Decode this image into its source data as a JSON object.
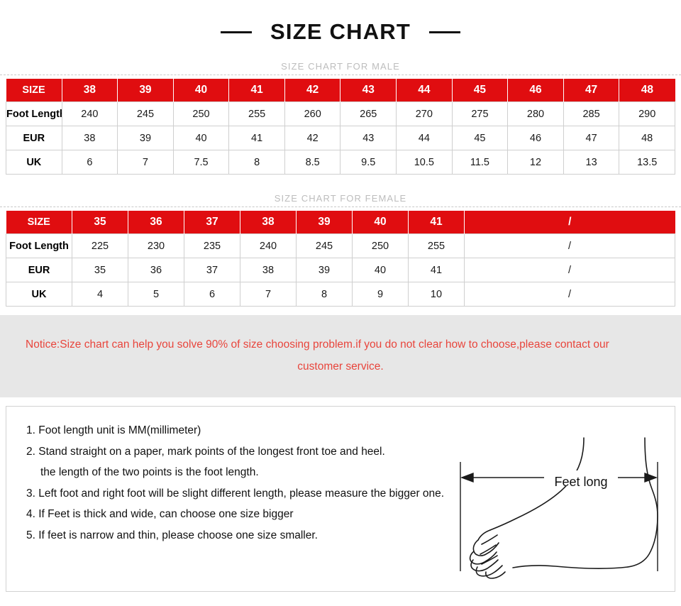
{
  "title": {
    "text": "SIZE CHART",
    "left_dash": "dash",
    "right_dash": "dash"
  },
  "male_section": {
    "caption": "SIZE CHART FOR MALE",
    "columns": [
      "SIZE",
      "38",
      "39",
      "40",
      "41",
      "42",
      "43",
      "44",
      "45",
      "46",
      "47",
      "48"
    ],
    "rows": [
      {
        "label": "Foot Length",
        "values": [
          "240",
          "245",
          "250",
          "255",
          "260",
          "265",
          "270",
          "275",
          "280",
          "285",
          "290"
        ]
      },
      {
        "label": "EUR",
        "values": [
          "38",
          "39",
          "40",
          "41",
          "42",
          "43",
          "44",
          "45",
          "46",
          "47",
          "48"
        ]
      },
      {
        "label": "UK",
        "values": [
          "6",
          "7",
          "7.5",
          "8",
          "8.5",
          "9.5",
          "10.5",
          "11.5",
          "12",
          "13",
          "13.5"
        ]
      }
    ]
  },
  "female_section": {
    "caption": "SIZE CHART FOR FEMALE",
    "columns": [
      "SIZE",
      "35",
      "36",
      "37",
      "38",
      "39",
      "40",
      "41"
    ],
    "merged_header": "/",
    "rows": [
      {
        "label": "Foot Length",
        "values": [
          "225",
          "230",
          "235",
          "240",
          "245",
          "250",
          "255"
        ],
        "merged": "/"
      },
      {
        "label": "EUR",
        "values": [
          "35",
          "36",
          "37",
          "38",
          "39",
          "40",
          "41"
        ],
        "merged": "/"
      },
      {
        "label": "UK",
        "values": [
          "4",
          "5",
          "6",
          "7",
          "8",
          "9",
          "10"
        ],
        "merged": "/"
      }
    ]
  },
  "notice": {
    "line1": "Notice:Size chart can help you solve 90% of size choosing problem.if you do not clear how to choose,please contact our",
    "line2": "customer service."
  },
  "instructions": {
    "items": [
      "1. Foot length unit is MM(millimeter)",
      "2. Stand straight on a paper, mark points of the longest front toe and heel.",
      "the length of the two points is the foot length.",
      "3. Left foot and right foot will be slight different length, please measure the bigger one.",
      "4. If Feet is thick and wide, can choose one size bigger",
      "5. If feet is narrow and thin, please choose one size smaller."
    ]
  },
  "figure": {
    "label": "Feet long",
    "name": "foot-side-view-diagram"
  },
  "colors": {
    "red_header": "#e00d10",
    "notice_text": "#e8453c",
    "notice_background": "#e7e7e7",
    "caption_gray": "#bdbdbd",
    "cell_border": "#cfcfcf"
  }
}
